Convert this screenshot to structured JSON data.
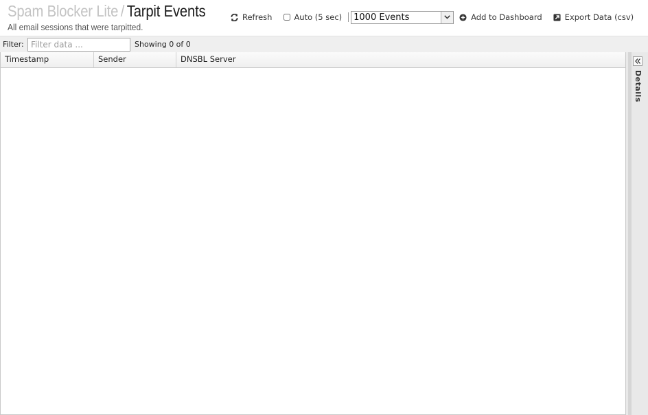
{
  "header": {
    "title_parent": "Spam Blocker Lite",
    "title_separator": "/",
    "title_current": "Tarpit Events",
    "subtitle": "All email sessions that were tarpitted."
  },
  "toolbar": {
    "refresh_label": "Refresh",
    "auto_label": "Auto (5 sec)",
    "auto_checked": false,
    "events_select_value": "1000 Events",
    "add_dashboard_label": "Add to Dashboard",
    "export_label": "Export Data (csv)"
  },
  "filter": {
    "label": "Filter:",
    "placeholder": "Filter data ...",
    "value": "",
    "showing_text": "Showing 0 of 0"
  },
  "grid": {
    "columns": [
      "Timestamp",
      "Sender",
      "DNSBL Server"
    ],
    "rows": []
  },
  "details_panel": {
    "label": "Details"
  },
  "icons": {
    "refresh": "refresh-icon",
    "add": "plus-circle-icon",
    "export": "export-icon",
    "dropdown": "chevron-down-icon",
    "collapse": "double-chevron-left-icon"
  }
}
